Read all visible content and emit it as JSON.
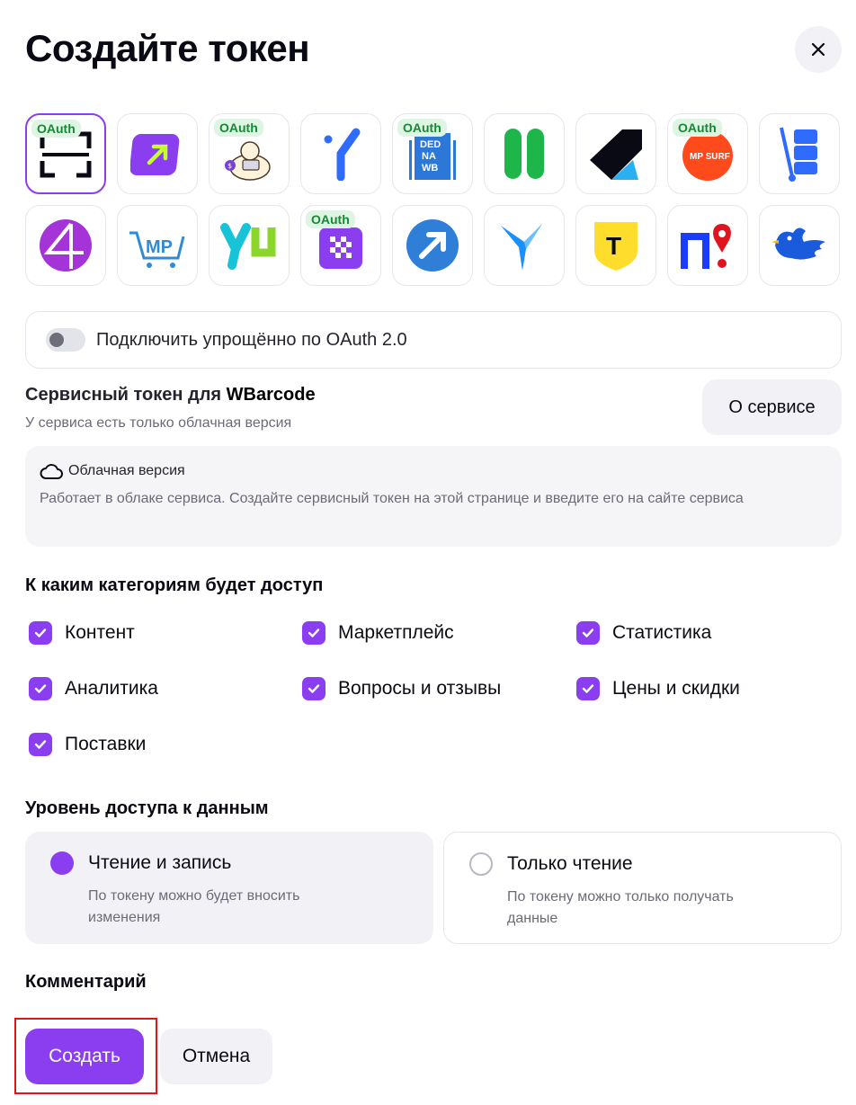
{
  "dialog": {
    "title": "Создайте токен"
  },
  "services": [
    {
      "name": "wbarcode",
      "oauth": true,
      "selected": true
    },
    {
      "name": "arrow-service",
      "oauth": false
    },
    {
      "name": "monkey-service",
      "oauth": true
    },
    {
      "name": "y-service",
      "oauth": false
    },
    {
      "name": "dedna-wb",
      "oauth": true,
      "logo_text": [
        "DED",
        "NA",
        "WB"
      ]
    },
    {
      "name": "green-bars-service",
      "oauth": false
    },
    {
      "name": "kosmos-service",
      "oauth": false
    },
    {
      "name": "mp-surf",
      "oauth": true,
      "logo_text": "MP SURF"
    },
    {
      "name": "cart-service",
      "oauth": false
    },
    {
      "name": "four-service",
      "oauth": false
    },
    {
      "name": "mp-cart-service",
      "oauth": false,
      "logo_text": "MP"
    },
    {
      "name": "yu-service",
      "oauth": false
    },
    {
      "name": "checker-service",
      "oauth": true
    },
    {
      "name": "blue-arrow-service",
      "oauth": false
    },
    {
      "name": "bird-service",
      "oauth": false
    },
    {
      "name": "tbank-service",
      "oauth": false,
      "logo_text": "T"
    },
    {
      "name": "pin-service",
      "oauth": false
    },
    {
      "name": "dove-service",
      "oauth": false
    }
  ],
  "oauth_badge": "OAuth",
  "oauth_toggle": {
    "label": "Подключить упрощённо по OAuth 2.0",
    "checked": false
  },
  "service": {
    "title_prefix": "Сервисный токен для ",
    "name": "WBarcode",
    "subtitle": "У сервиса есть только облачная версия",
    "about_button": "О сервисе"
  },
  "cloud": {
    "title": "Облачная версия",
    "description": "Работает в облаке сервиса. Создайте сервисный токен на этой странице и введите его на сайте сервиса"
  },
  "categories": {
    "title": "К каким категориям будет доступ",
    "items": [
      {
        "label": "Контент",
        "checked": true
      },
      {
        "label": "Маркетплейс",
        "checked": true
      },
      {
        "label": "Статистика",
        "checked": true
      },
      {
        "label": "Аналитика",
        "checked": true
      },
      {
        "label": "Вопросы и отзывы",
        "checked": true
      },
      {
        "label": "Цены и скидки",
        "checked": true
      },
      {
        "label": "Поставки",
        "checked": true
      }
    ]
  },
  "access": {
    "title": "Уровень доступа к данным",
    "options": [
      {
        "title": "Чтение и запись",
        "description": "По токену можно будет вносить изменения",
        "selected": true
      },
      {
        "title": "Только чтение",
        "description": "По токену можно только получать данные",
        "selected": false
      }
    ]
  },
  "comment": {
    "title": "Комментарий"
  },
  "actions": {
    "create": "Создать",
    "cancel": "Отмена"
  },
  "colors": {
    "accent": "#8b3ef0",
    "oauth_badge_bg": "#dff5e3",
    "oauth_badge_text": "#148a34",
    "highlight": "#e0141e"
  }
}
